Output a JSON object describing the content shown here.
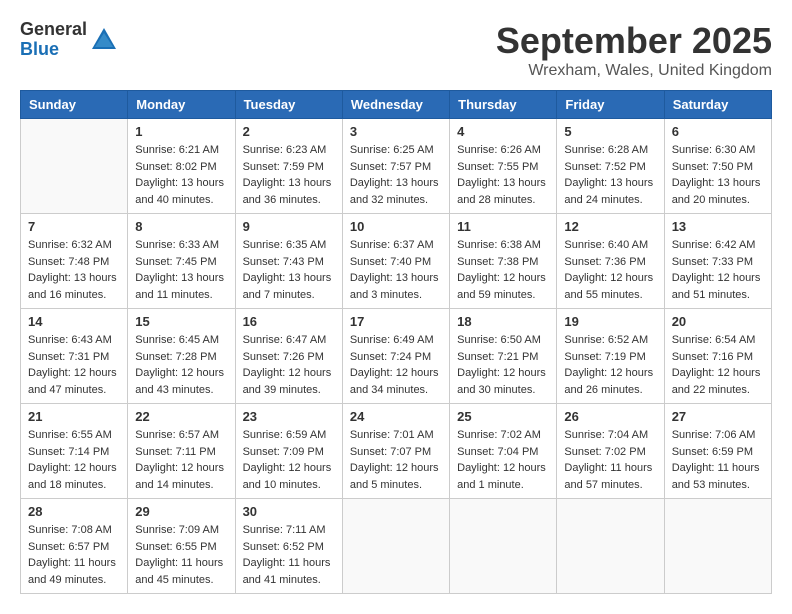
{
  "logo": {
    "general": "General",
    "blue": "Blue"
  },
  "title": "September 2025",
  "location": "Wrexham, Wales, United Kingdom",
  "days_of_week": [
    "Sunday",
    "Monday",
    "Tuesday",
    "Wednesday",
    "Thursday",
    "Friday",
    "Saturday"
  ],
  "weeks": [
    [
      {
        "day": "",
        "info": ""
      },
      {
        "day": "1",
        "info": "Sunrise: 6:21 AM\nSunset: 8:02 PM\nDaylight: 13 hours\nand 40 minutes."
      },
      {
        "day": "2",
        "info": "Sunrise: 6:23 AM\nSunset: 7:59 PM\nDaylight: 13 hours\nand 36 minutes."
      },
      {
        "day": "3",
        "info": "Sunrise: 6:25 AM\nSunset: 7:57 PM\nDaylight: 13 hours\nand 32 minutes."
      },
      {
        "day": "4",
        "info": "Sunrise: 6:26 AM\nSunset: 7:55 PM\nDaylight: 13 hours\nand 28 minutes."
      },
      {
        "day": "5",
        "info": "Sunrise: 6:28 AM\nSunset: 7:52 PM\nDaylight: 13 hours\nand 24 minutes."
      },
      {
        "day": "6",
        "info": "Sunrise: 6:30 AM\nSunset: 7:50 PM\nDaylight: 13 hours\nand 20 minutes."
      }
    ],
    [
      {
        "day": "7",
        "info": "Sunrise: 6:32 AM\nSunset: 7:48 PM\nDaylight: 13 hours\nand 16 minutes."
      },
      {
        "day": "8",
        "info": "Sunrise: 6:33 AM\nSunset: 7:45 PM\nDaylight: 13 hours\nand 11 minutes."
      },
      {
        "day": "9",
        "info": "Sunrise: 6:35 AM\nSunset: 7:43 PM\nDaylight: 13 hours\nand 7 minutes."
      },
      {
        "day": "10",
        "info": "Sunrise: 6:37 AM\nSunset: 7:40 PM\nDaylight: 13 hours\nand 3 minutes."
      },
      {
        "day": "11",
        "info": "Sunrise: 6:38 AM\nSunset: 7:38 PM\nDaylight: 12 hours\nand 59 minutes."
      },
      {
        "day": "12",
        "info": "Sunrise: 6:40 AM\nSunset: 7:36 PM\nDaylight: 12 hours\nand 55 minutes."
      },
      {
        "day": "13",
        "info": "Sunrise: 6:42 AM\nSunset: 7:33 PM\nDaylight: 12 hours\nand 51 minutes."
      }
    ],
    [
      {
        "day": "14",
        "info": "Sunrise: 6:43 AM\nSunset: 7:31 PM\nDaylight: 12 hours\nand 47 minutes."
      },
      {
        "day": "15",
        "info": "Sunrise: 6:45 AM\nSunset: 7:28 PM\nDaylight: 12 hours\nand 43 minutes."
      },
      {
        "day": "16",
        "info": "Sunrise: 6:47 AM\nSunset: 7:26 PM\nDaylight: 12 hours\nand 39 minutes."
      },
      {
        "day": "17",
        "info": "Sunrise: 6:49 AM\nSunset: 7:24 PM\nDaylight: 12 hours\nand 34 minutes."
      },
      {
        "day": "18",
        "info": "Sunrise: 6:50 AM\nSunset: 7:21 PM\nDaylight: 12 hours\nand 30 minutes."
      },
      {
        "day": "19",
        "info": "Sunrise: 6:52 AM\nSunset: 7:19 PM\nDaylight: 12 hours\nand 26 minutes."
      },
      {
        "day": "20",
        "info": "Sunrise: 6:54 AM\nSunset: 7:16 PM\nDaylight: 12 hours\nand 22 minutes."
      }
    ],
    [
      {
        "day": "21",
        "info": "Sunrise: 6:55 AM\nSunset: 7:14 PM\nDaylight: 12 hours\nand 18 minutes."
      },
      {
        "day": "22",
        "info": "Sunrise: 6:57 AM\nSunset: 7:11 PM\nDaylight: 12 hours\nand 14 minutes."
      },
      {
        "day": "23",
        "info": "Sunrise: 6:59 AM\nSunset: 7:09 PM\nDaylight: 12 hours\nand 10 minutes."
      },
      {
        "day": "24",
        "info": "Sunrise: 7:01 AM\nSunset: 7:07 PM\nDaylight: 12 hours\nand 5 minutes."
      },
      {
        "day": "25",
        "info": "Sunrise: 7:02 AM\nSunset: 7:04 PM\nDaylight: 12 hours\nand 1 minute."
      },
      {
        "day": "26",
        "info": "Sunrise: 7:04 AM\nSunset: 7:02 PM\nDaylight: 11 hours\nand 57 minutes."
      },
      {
        "day": "27",
        "info": "Sunrise: 7:06 AM\nSunset: 6:59 PM\nDaylight: 11 hours\nand 53 minutes."
      }
    ],
    [
      {
        "day": "28",
        "info": "Sunrise: 7:08 AM\nSunset: 6:57 PM\nDaylight: 11 hours\nand 49 minutes."
      },
      {
        "day": "29",
        "info": "Sunrise: 7:09 AM\nSunset: 6:55 PM\nDaylight: 11 hours\nand 45 minutes."
      },
      {
        "day": "30",
        "info": "Sunrise: 7:11 AM\nSunset: 6:52 PM\nDaylight: 11 hours\nand 41 minutes."
      },
      {
        "day": "",
        "info": ""
      },
      {
        "day": "",
        "info": ""
      },
      {
        "day": "",
        "info": ""
      },
      {
        "day": "",
        "info": ""
      }
    ]
  ]
}
